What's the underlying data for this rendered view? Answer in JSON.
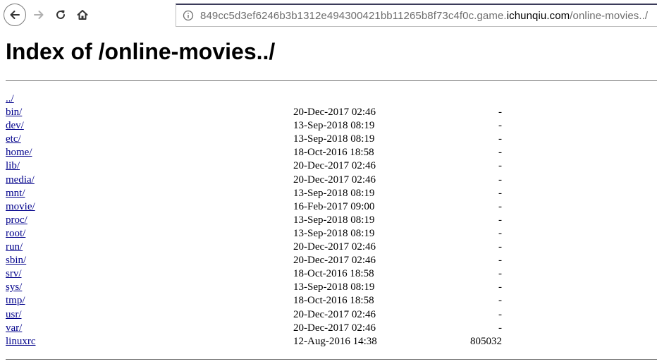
{
  "browser": {
    "url_prefix": "849cc5d3ef6246b3b1312e494300421bb11265b8f73c4f0c.game.",
    "url_domain": "ichunqiu.com",
    "url_path": "/online-movies../"
  },
  "page": {
    "title": "Index of /online-movies../"
  },
  "entries": [
    {
      "name": "../",
      "date": "",
      "size": ""
    },
    {
      "name": "bin/",
      "date": "20-Dec-2017 02:46",
      "size": "-"
    },
    {
      "name": "dev/",
      "date": "13-Sep-2018 08:19",
      "size": "-"
    },
    {
      "name": "etc/",
      "date": "13-Sep-2018 08:19",
      "size": "-"
    },
    {
      "name": "home/",
      "date": "18-Oct-2016 18:58",
      "size": "-"
    },
    {
      "name": "lib/",
      "date": "20-Dec-2017 02:46",
      "size": "-"
    },
    {
      "name": "media/",
      "date": "20-Dec-2017 02:46",
      "size": "-"
    },
    {
      "name": "mnt/",
      "date": "13-Sep-2018 08:19",
      "size": "-"
    },
    {
      "name": "movie/",
      "date": "16-Feb-2017 09:00",
      "size": "-"
    },
    {
      "name": "proc/",
      "date": "13-Sep-2018 08:19",
      "size": "-"
    },
    {
      "name": "root/",
      "date": "13-Sep-2018 08:19",
      "size": "-"
    },
    {
      "name": "run/",
      "date": "20-Dec-2017 02:46",
      "size": "-"
    },
    {
      "name": "sbin/",
      "date": "20-Dec-2017 02:46",
      "size": "-"
    },
    {
      "name": "srv/",
      "date": "18-Oct-2016 18:58",
      "size": "-"
    },
    {
      "name": "sys/",
      "date": "13-Sep-2018 08:19",
      "size": "-"
    },
    {
      "name": "tmp/",
      "date": "18-Oct-2016 18:58",
      "size": "-"
    },
    {
      "name": "usr/",
      "date": "20-Dec-2017 02:46",
      "size": "-"
    },
    {
      "name": "var/",
      "date": "20-Dec-2017 02:46",
      "size": "-"
    },
    {
      "name": "linuxrc",
      "date": "12-Aug-2016 14:38",
      "size": "805032"
    }
  ],
  "colors": {
    "link": "#00008b",
    "url_muted": "#6e6e6e"
  }
}
